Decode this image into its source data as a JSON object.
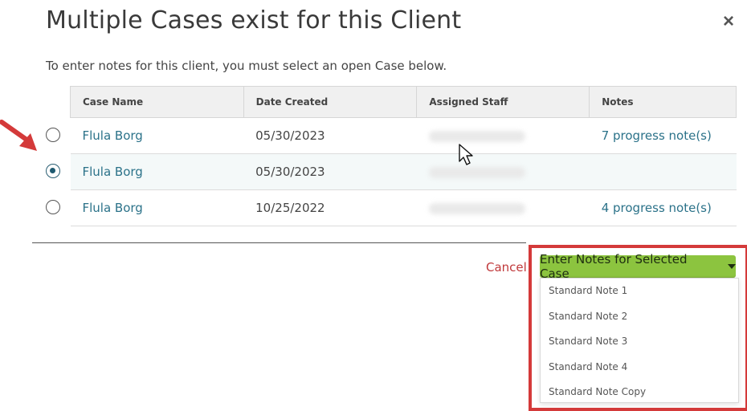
{
  "dialog": {
    "title": "Multiple Cases exist for this Client",
    "close_icon": "×",
    "instructions": "To enter notes for this client, you must select an open Case below."
  },
  "table": {
    "headers": [
      "Case Name",
      "Date Created",
      "Assigned Staff",
      "Notes"
    ],
    "rows": [
      {
        "case_name": "Flula Borg",
        "date_created": "05/30/2023",
        "notes": "7 progress note(s)",
        "selected": false
      },
      {
        "case_name": "Flula Borg",
        "date_created": "05/30/2023",
        "notes": "",
        "selected": true
      },
      {
        "case_name": "Flula Borg",
        "date_created": "10/25/2022",
        "notes": "4 progress note(s)",
        "selected": false
      }
    ]
  },
  "footer": {
    "cancel_label": "Cancel",
    "enter_notes_label": "Enter Notes for Selected Case"
  },
  "dropdown": {
    "items": [
      "Standard Note 1",
      "Standard Note 2",
      "Standard Note 3",
      "Standard Note 4",
      "Standard Note Copy"
    ]
  },
  "colors": {
    "accent_green": "#8cc43f",
    "link_teal": "#2b7289",
    "cancel_red": "#c0393b",
    "annotation_red": "#d43a3a"
  }
}
